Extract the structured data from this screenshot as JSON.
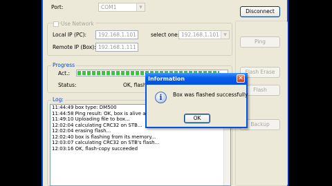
{
  "connection": {
    "port_label": "Port:",
    "port_value": "COM1",
    "use_network_label": "Use Network",
    "local_ip_label": "Local IP (PC):",
    "local_ip_value": "192.168.1.101",
    "select_one_label": "select one:",
    "select_one_value": "192.168.1.101",
    "remote_ip_label": "Remote IP (Box):",
    "remote_ip_value": "192.168.1.111"
  },
  "progress": {
    "group_title": "Progress",
    "act_label": "Act.:",
    "act_fraction": 0.95,
    "status_label": "Status:",
    "status_value": "OK, flash-c"
  },
  "log": {
    "group_title": "Log:",
    "lines": [
      "11:44:49 box type: DM500",
      "11:44:58 Ping result: OK, box is alive and s",
      "11:49:10 Uploading file to box...",
      "12:02:04 calculating CRC32 on STB...",
      "12:02:04 erasing flash...",
      "12:02:40 box is flashing from its memory...",
      "12:03:07 calculating CRC32 on STB's flash...",
      "12:03:16 OK, flash-copy succeeded"
    ]
  },
  "buttons": {
    "disconnect": "Disconnect",
    "ping": "Ping",
    "flash_erase": "Flash Erase",
    "flash": "Flash",
    "backup": "Backup"
  },
  "dialog": {
    "title": "Information",
    "message": "Box was flashed successfully",
    "ok": "OK",
    "close_glyph": "✕",
    "icon_glyph": "i"
  }
}
